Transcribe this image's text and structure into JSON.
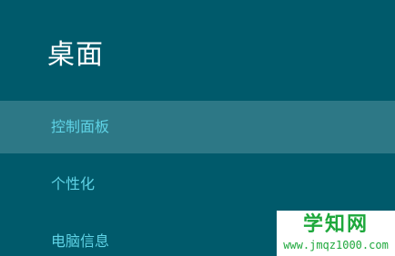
{
  "panel": {
    "title": "桌面",
    "items": [
      {
        "label": "控制面板",
        "selected": true
      },
      {
        "label": "个性化",
        "selected": false
      },
      {
        "label": "电脑信息",
        "selected": false
      }
    ]
  },
  "watermark": {
    "title": "学知网",
    "url": "www.jmqz1000.com"
  },
  "colors": {
    "background": "#005a6b",
    "selected_background": "#2d7886",
    "item_text": "#5fd3e6",
    "title_text": "#ffffff",
    "watermark_text": "#1ea83c"
  }
}
